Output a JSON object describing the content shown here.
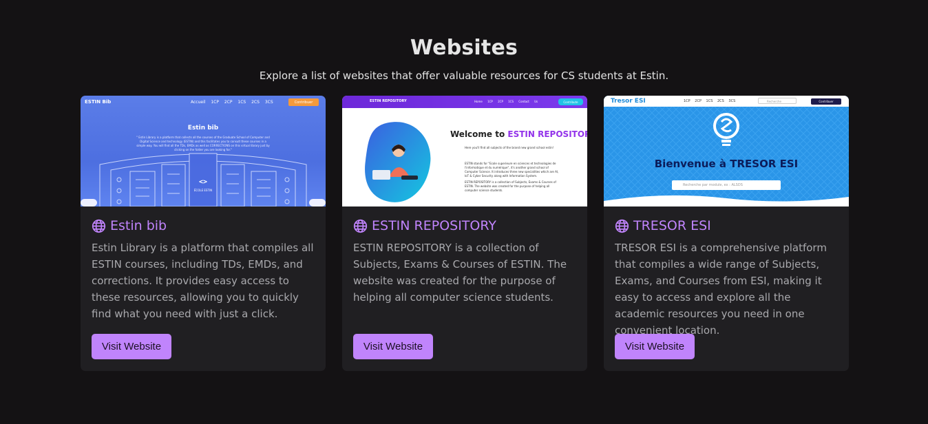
{
  "section": {
    "title": "Websites",
    "subtitle": "Explore a list of websites that offer valuable resources for CS students at Estin."
  },
  "icons": {
    "card_title": "globe-icon"
  },
  "colors": {
    "accent": "#c084fc",
    "background": "#141214",
    "card": "#201f22"
  },
  "cards": [
    {
      "title": "Estin bib",
      "description": "Estin Library is a platform that compiles all ESTIN courses, including TDs, EMDs, and corrections. It provides easy access to these resources, allowing you to quickly find what you need with just a click.",
      "button": "Visit Website",
      "screenshot": {
        "brand": "ESTIN Bib",
        "nav": "Accueil 1CP 2CP 1CS 2CS 3CS",
        "cta": "Contribuer",
        "heading": "Estin bib",
        "text": "\" Estin Library is a platform that collects all the courses of the Graduate School of Computer and Digital Science and technology (ESTIN) and this facilitates you to consult these courses in a simple way. You will find all the TDs, EMDs as well as CORRECTIONS on this virtual library just by clicking on the folder you are looking for.\"",
        "building": "ÉCOLE ESTIN"
      }
    },
    {
      "title": "ESTIN REPOSITORY",
      "description": "ESTIN REPOSITORY is a collection of Subjects, Exams & Courses of ESTIN. The website was created for the purpose of helping all computer science students.",
      "button": "Visit Website",
      "screenshot": {
        "brand": "ESTIN REPOSITORY",
        "nav": "Home 1CP 2CP 1CS Contact Us",
        "cta": "Contribute",
        "heading_prefix": "Welcome to",
        "heading_highlight": "ESTIN REPOSITORY",
        "line1": "Here you'll find all subjects of the brand new grand school estin!",
        "line2": "ESTIN stands for \"Ecole superieure en sciences et technologies de l'informatique et du numérique\", it's another grand school of Computer Science. It introduces three new specialities which are AI, IoT & Cyber Security along with Information System.",
        "line3": "ESTIN REPOSITORY is a collection of Subjects, Exams & Courses of ESTIN. The website was created for the purpose of helping all computer science students."
      }
    },
    {
      "title": "TRESOR ESI",
      "description": "TRESOR ESI is a comprehensive platform that compiles a wide range of Subjects, Exams, and Courses from ESI, making it easy to access and explore all the academic resources you need in one convenient location.",
      "button": "Visit Website",
      "screenshot": {
        "brand": "Tresor ESI",
        "nav": "1CP 2CP 1CS 2CS 3CS",
        "search_placeholder": "Recherche",
        "cta": "Contribuer",
        "heading_prefix": "Bienvenue à",
        "heading_highlight": "TRESOR ESI",
        "input_placeholder": "Recherche par module, ex : ALSDS"
      }
    }
  ]
}
